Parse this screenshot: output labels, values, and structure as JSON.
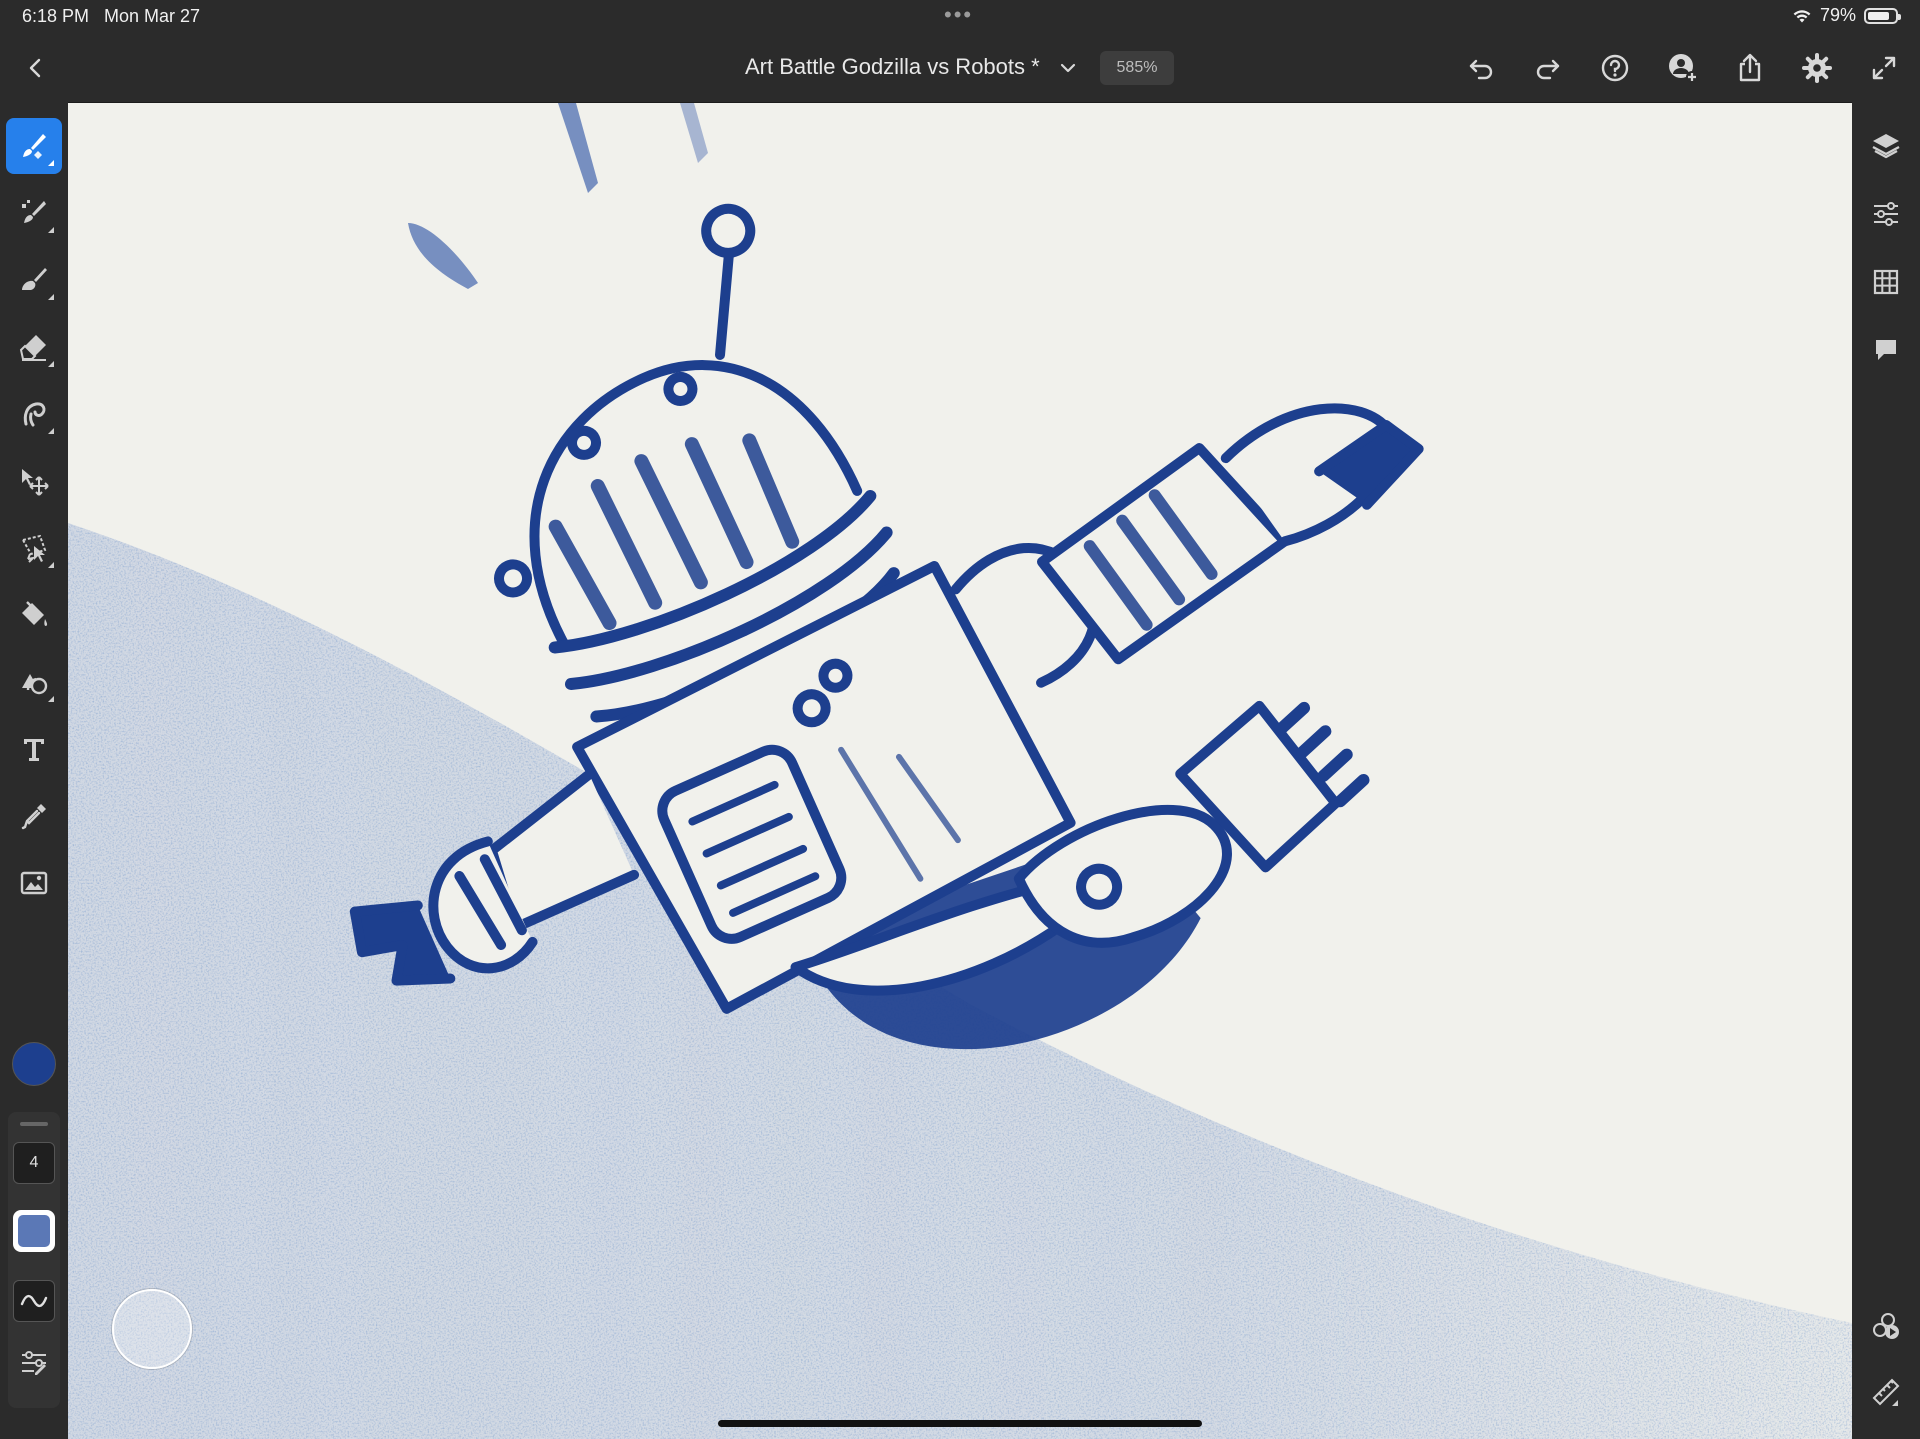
{
  "status_bar": {
    "time": "6:18 PM",
    "date": "Mon Mar 27",
    "battery": "79%",
    "battery_level": 0.79,
    "icons": [
      "wifi-icon",
      "battery-icon"
    ]
  },
  "toolbar": {
    "document_title": "Art Battle Godzilla vs Robots *",
    "zoom": "585%",
    "icons": [
      "back-icon",
      "chevron-down-icon",
      "undo-icon",
      "redo-icon",
      "help-icon",
      "invite-icon",
      "share-icon",
      "settings-icon",
      "fullscreen-icon"
    ]
  },
  "left_tools": {
    "active": "paint-brush-tool",
    "items": [
      "paint-brush-tool",
      "pixel-brush-tool",
      "smudge-tool",
      "eraser-tool",
      "liquify-tool",
      "move-tool",
      "lasso-selection-tool",
      "fill-tool",
      "shape-tool",
      "text-tool",
      "eyedropper-tool",
      "image-tool"
    ],
    "color": "#1d3f8e"
  },
  "brush_panel": {
    "size": "4",
    "opacity_color": "#5b78b6",
    "icons": [
      "brush-smoothing-icon",
      "brush-settings-icon"
    ]
  },
  "right_tools": {
    "items": [
      "layers-icon",
      "layer-properties-icon",
      "grid-icon",
      "comments-icon",
      "timelapse-icon",
      "ruler-icon"
    ]
  },
  "canvas": {
    "background": "#f1f1ec",
    "ink_color": "#1d3f8e",
    "subject": "robot"
  }
}
